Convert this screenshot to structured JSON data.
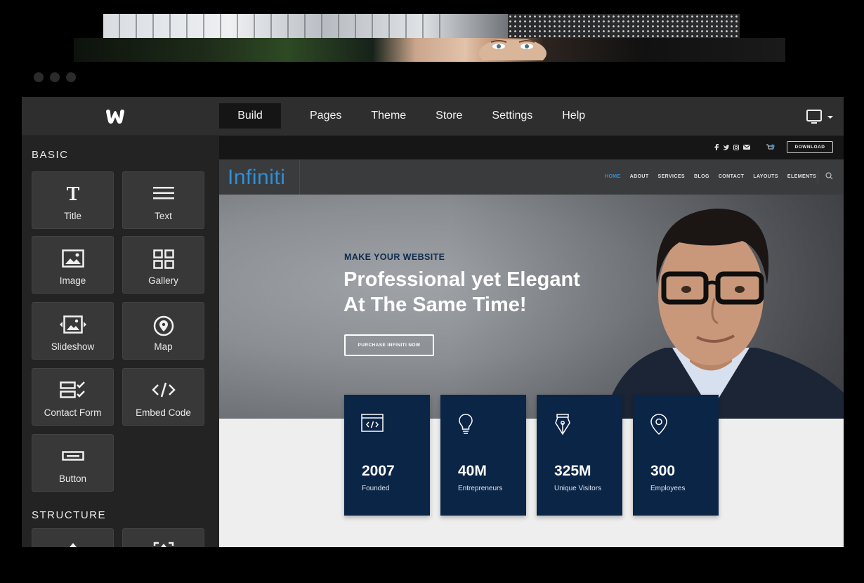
{
  "nav": {
    "items": [
      {
        "label": "Build",
        "active": true
      },
      {
        "label": "Pages"
      },
      {
        "label": "Theme"
      },
      {
        "label": "Store"
      },
      {
        "label": "Settings"
      },
      {
        "label": "Help"
      }
    ]
  },
  "sidebar": {
    "basic_title": "BASIC",
    "structure_title": "STRUCTURE",
    "tiles": [
      {
        "label": "Title",
        "icon": "title-icon"
      },
      {
        "label": "Text",
        "icon": "text-icon"
      },
      {
        "label": "Image",
        "icon": "image-icon"
      },
      {
        "label": "Gallery",
        "icon": "gallery-icon"
      },
      {
        "label": "Slideshow",
        "icon": "slideshow-icon"
      },
      {
        "label": "Map",
        "icon": "map-pin-icon"
      },
      {
        "label": "Contact Form",
        "icon": "contact-form-icon"
      },
      {
        "label": "Embed Code",
        "icon": "embed-code-icon"
      },
      {
        "label": "Button",
        "icon": "button-icon"
      }
    ]
  },
  "preview": {
    "download_label": "DOWNLOAD",
    "brand": "Infiniti",
    "menu": [
      "HOME",
      "ABOUT",
      "SERVICES",
      "BLOG",
      "CONTACT",
      "LAYOUTS",
      "ELEMENTS"
    ],
    "hero": {
      "eyebrow": "MAKE YOUR WEBSITE",
      "headline_line1": "Professional yet Elegant",
      "headline_line2": "At The Same Time!",
      "cta": "PURCHASE INFINITI NOW"
    },
    "stats": [
      {
        "value": "2007",
        "caption": "Founded",
        "icon": "code-window-icon"
      },
      {
        "value": "40M",
        "caption": "Entrepreneurs",
        "icon": "lightbulb-icon"
      },
      {
        "value": "325M",
        "caption": "Unique Visitors",
        "icon": "pen-nib-icon"
      },
      {
        "value": "300",
        "caption": "Employees",
        "icon": "location-pin-icon"
      }
    ]
  },
  "colors": {
    "brand_blue": "#2f8fd8",
    "stat_card": "#0b2547",
    "toolbar": "#2e2e2e"
  }
}
